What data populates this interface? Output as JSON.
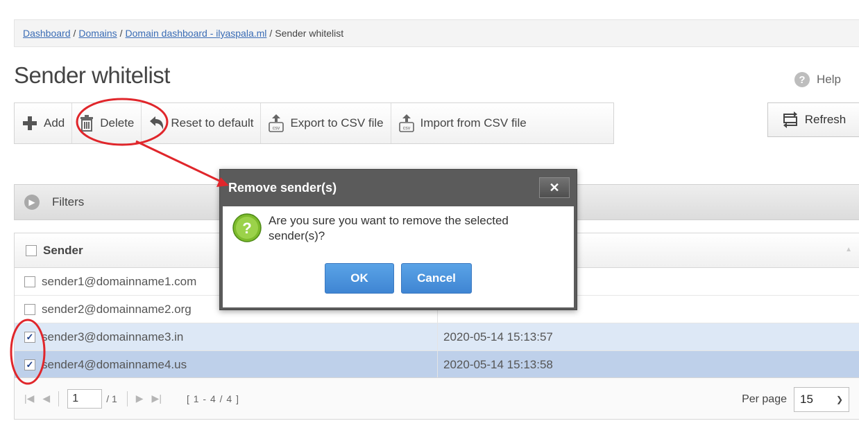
{
  "breadcrumb": {
    "items": [
      "Dashboard",
      "Domains",
      "Domain dashboard - ilyaspala.ml"
    ],
    "current": "Sender whitelist",
    "separator": "/"
  },
  "page": {
    "title": "Sender whitelist"
  },
  "help": {
    "label": "Help"
  },
  "toolbar": {
    "add": "Add",
    "delete": "Delete",
    "reset": "Reset to default",
    "export": "Export to CSV file",
    "import": "Import from CSV file"
  },
  "refresh": {
    "label": "Refresh"
  },
  "filters": {
    "label": "Filters"
  },
  "grid": {
    "header": "Sender",
    "rows": [
      {
        "sender": "sender1@domainname1.com",
        "date": "",
        "checked": false
      },
      {
        "sender": "sender2@domainname2.org",
        "date": "",
        "checked": false
      },
      {
        "sender": "sender3@domainname3.in",
        "date": "2020-05-14 15:13:57",
        "checked": true
      },
      {
        "sender": "sender4@domainname4.us",
        "date": "2020-05-14 15:13:58",
        "checked": true
      }
    ]
  },
  "pager": {
    "page": "1",
    "total": "/ 1",
    "range": "[ 1 - 4 / 4 ]",
    "per_page_label": "Per page",
    "per_page_value": "15"
  },
  "dialog": {
    "title": "Remove sender(s)",
    "close": "✕",
    "message": "Are you sure you want to remove the selected sender(s)?",
    "ok": "OK",
    "cancel": "Cancel"
  },
  "colors": {
    "annotation": "#e0262b",
    "dialog_frame": "#5b5b5b",
    "button_blue": "#4a90dc",
    "selected_row_light": "#dde8f6",
    "selected_row_dark": "#bed0ea"
  },
  "icons": {
    "help": "question-circle-icon",
    "add": "plus-icon",
    "delete": "trash-icon",
    "reset": "undo-arrow-icon",
    "export": "csv-export-icon",
    "import": "csv-import-icon",
    "refresh": "refresh-icon",
    "filters": "chevron-right-circle-icon",
    "dialog": "question-mark-icon"
  }
}
